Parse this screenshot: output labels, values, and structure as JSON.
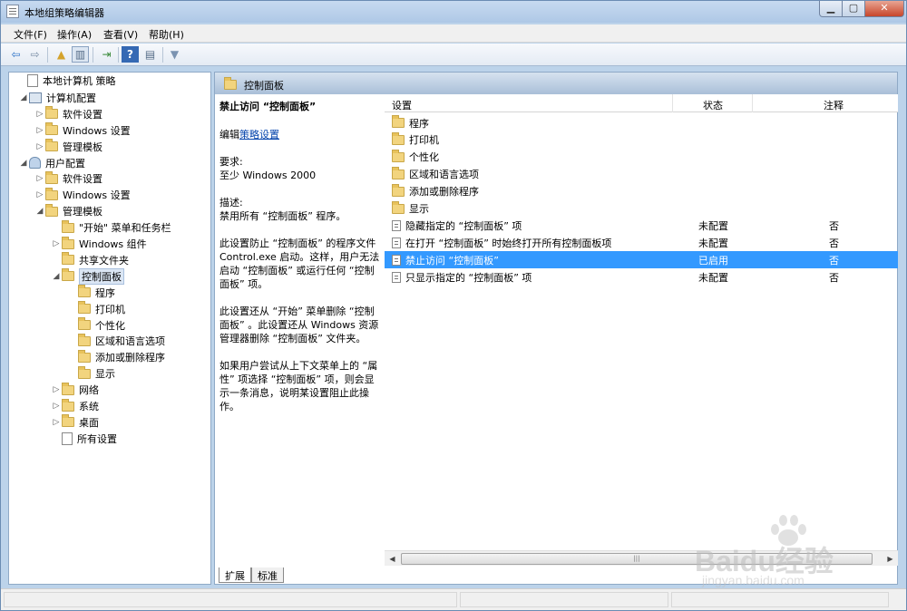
{
  "window": {
    "title": "本地组策略编辑器",
    "controls": {
      "minimize": "▁",
      "maximize": "▢",
      "close": "✕"
    }
  },
  "menu": [
    "文件(F)",
    "操作(A)",
    "查看(V)",
    "帮助(H)"
  ],
  "toolbar": {
    "buttons": [
      {
        "name": "back-icon",
        "glyph": "⇦"
      },
      {
        "name": "forward-icon",
        "glyph": "⇨"
      },
      {
        "name": "up-folder-icon",
        "glyph": "▲"
      },
      {
        "name": "show-hide-tree-icon",
        "glyph": "▥"
      },
      {
        "name": "export-list-icon",
        "glyph": "⇥"
      },
      {
        "name": "help-icon",
        "glyph": "?"
      },
      {
        "name": "properties-icon",
        "glyph": "▤"
      },
      {
        "name": "filter-icon",
        "glyph": "▼"
      }
    ]
  },
  "tree": [
    {
      "label": "本地计算机 策略",
      "level": 0,
      "icon": "doc",
      "arrow": ""
    },
    {
      "label": "计算机配置",
      "level": 1,
      "icon": "pc",
      "arrow": "◢"
    },
    {
      "label": "软件设置",
      "level": 2,
      "icon": "folder",
      "arrow": "▷"
    },
    {
      "label": "Windows 设置",
      "level": 2,
      "icon": "folder",
      "arrow": "▷"
    },
    {
      "label": "管理模板",
      "level": 2,
      "icon": "folder",
      "arrow": "▷"
    },
    {
      "label": "用户配置",
      "level": 1,
      "icon": "user",
      "arrow": "◢"
    },
    {
      "label": "软件设置",
      "level": 2,
      "icon": "folder",
      "arrow": "▷"
    },
    {
      "label": "Windows 设置",
      "level": 2,
      "icon": "folder",
      "arrow": "▷"
    },
    {
      "label": "管理模板",
      "level": 2,
      "icon": "folder",
      "arrow": "◢"
    },
    {
      "label": "\"开始\" 菜单和任务栏",
      "level": 3,
      "icon": "folder",
      "arrow": ""
    },
    {
      "label": "Windows 组件",
      "level": 3,
      "icon": "folder",
      "arrow": "▷"
    },
    {
      "label": "共享文件夹",
      "level": 3,
      "icon": "folder",
      "arrow": ""
    },
    {
      "label": "控制面板",
      "level": 3,
      "icon": "folder",
      "arrow": "◢",
      "selected": true
    },
    {
      "label": "程序",
      "level": 4,
      "icon": "folder",
      "arrow": ""
    },
    {
      "label": "打印机",
      "level": 4,
      "icon": "folder",
      "arrow": ""
    },
    {
      "label": "个性化",
      "level": 4,
      "icon": "folder",
      "arrow": ""
    },
    {
      "label": "区域和语言选项",
      "level": 4,
      "icon": "folder",
      "arrow": ""
    },
    {
      "label": "添加或删除程序",
      "level": 4,
      "icon": "folder",
      "arrow": ""
    },
    {
      "label": "显示",
      "level": 4,
      "icon": "folder",
      "arrow": ""
    },
    {
      "label": "网络",
      "level": 3,
      "icon": "folder",
      "arrow": "▷"
    },
    {
      "label": "系统",
      "level": 3,
      "icon": "folder",
      "arrow": "▷"
    },
    {
      "label": "桌面",
      "level": 3,
      "icon": "folder",
      "arrow": "▷"
    },
    {
      "label": "所有设置",
      "level": 3,
      "icon": "doc",
      "arrow": ""
    }
  ],
  "panel": {
    "header": "控制面板",
    "description": {
      "title": "禁止访问 “控制面板”",
      "edit_prefix": "编辑",
      "edit_link": "策略设置",
      "requirement_label": "要求:",
      "requirement_value": "至少 Windows 2000",
      "desc_label": "描述:",
      "desc_value": "禁用所有 “控制面板” 程序。",
      "para1": "此设置防止 “控制面板” 的程序文件 Control.exe 启动。这样，用户无法启动 “控制面板” 或运行任何 “控制面板” 项。",
      "para2": "此设置还从 “开始” 菜单删除 “控制面板” 。此设置还从 Windows 资源管理器删除 “控制面板” 文件夹。",
      "para3": "如果用户尝试从上下文菜单上的 “属性” 项选择 “控制面板” 项，则会显示一条消息，说明某设置阻止此操作。"
    },
    "columns": {
      "setting": "设置",
      "state": "状态",
      "comment": "注释"
    },
    "rows": [
      {
        "type": "folder",
        "name": "程序",
        "state": "",
        "comment": ""
      },
      {
        "type": "folder",
        "name": "打印机",
        "state": "",
        "comment": ""
      },
      {
        "type": "folder",
        "name": "个性化",
        "state": "",
        "comment": ""
      },
      {
        "type": "folder",
        "name": "区域和语言选项",
        "state": "",
        "comment": ""
      },
      {
        "type": "folder",
        "name": "添加或删除程序",
        "state": "",
        "comment": ""
      },
      {
        "type": "folder",
        "name": "显示",
        "state": "",
        "comment": ""
      },
      {
        "type": "setting",
        "name": "隐藏指定的 “控制面板” 项",
        "state": "未配置",
        "comment": "否"
      },
      {
        "type": "setting",
        "name": "在打开 “控制面板” 时始终打开所有控制面板项",
        "state": "未配置",
        "comment": "否"
      },
      {
        "type": "setting",
        "name": "禁止访问 “控制面板”",
        "state": "已启用",
        "comment": "否",
        "selected": true
      },
      {
        "type": "setting",
        "name": "只显示指定的 “控制面板” 项",
        "state": "未配置",
        "comment": "否"
      }
    ],
    "tabs": [
      "扩展",
      "标准"
    ],
    "active_tab": "扩展"
  },
  "watermark": {
    "brand": "Baidu经验",
    "url": "jingyan.baidu.com"
  },
  "colors": {
    "selection": "#3399ff",
    "link": "#0645ad"
  }
}
